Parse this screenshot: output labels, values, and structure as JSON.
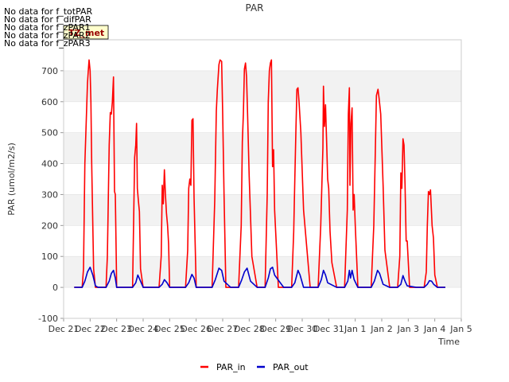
{
  "chart_data": {
    "type": "line",
    "title": "PAR",
    "xlabel": "Time",
    "ylabel": "PAR (umol/m2/s)",
    "ylim": [
      -100,
      800
    ],
    "yticks": [
      -100,
      0,
      100,
      200,
      300,
      400,
      500,
      600,
      700
    ],
    "xlim": [
      "2021-12-21",
      "2022-01-05"
    ],
    "xticks": [
      "Dec 21",
      "Dec 22",
      "Dec 23",
      "Dec 24",
      "Dec 25",
      "Dec 26",
      "Dec 27",
      "Dec 28",
      "Dec 29",
      "Dec 30",
      "Dec 31",
      "Jan 1",
      "Jan 2",
      "Jan 3",
      "Jan 4",
      "Jan 5"
    ],
    "grid": "horizontal bands",
    "legend_position": "bottom-center",
    "no_data_messages": [
      "No data for f_totPAR",
      "No data for f_difPAR",
      "No data for f_zPAR1",
      "No data for f_zPAR2",
      "No data for f_zPAR3"
    ],
    "badge": "TZ_met",
    "series": [
      {
        "name": "PAR_in",
        "color": "#ff0000",
        "x": [
          0.4,
          0.7,
          0.75,
          0.8,
          0.9,
          0.93,
          0.96,
          1.0,
          1.03,
          1.06,
          1.1,
          1.13,
          1.2,
          1.25,
          1.3,
          1.6,
          1.65,
          1.72,
          1.76,
          1.8,
          1.84,
          1.88,
          1.9,
          1.92,
          1.95,
          2.0,
          2.3,
          2.6,
          2.68,
          2.72,
          2.75,
          2.78,
          2.82,
          2.86,
          2.9,
          3.0,
          3.3,
          3.6,
          3.68,
          3.72,
          3.76,
          3.8,
          3.84,
          3.88,
          3.92,
          3.96,
          4.0,
          4.3,
          4.6,
          4.68,
          4.72,
          4.76,
          4.8,
          4.84,
          4.88,
          4.92,
          4.96,
          5.0,
          5.3,
          5.6,
          5.7,
          5.76,
          5.8,
          5.86,
          5.9,
          5.96,
          6.0,
          6.05,
          6.12,
          6.3,
          6.6,
          6.7,
          6.74,
          6.78,
          6.82,
          6.86,
          6.9,
          6.94,
          7.0,
          7.1,
          7.3,
          7.6,
          7.68,
          7.72,
          7.76,
          7.8,
          7.84,
          7.88,
          7.92,
          7.96,
          8.1,
          8.3,
          8.6,
          8.68,
          8.72,
          8.76,
          8.8,
          8.84,
          8.88,
          8.95,
          9.05,
          9.3,
          9.6,
          9.7,
          9.74,
          9.78,
          9.8,
          9.84,
          9.88,
          9.92,
          9.96,
          10.0,
          10.05,
          10.12,
          10.3,
          10.6,
          10.7,
          10.74,
          10.78,
          10.8,
          10.84,
          10.88,
          10.92,
          10.96,
          11.0,
          11.1,
          11.3,
          11.6,
          11.7,
          11.76,
          11.8,
          11.86,
          11.9,
          11.96,
          12.0,
          12.05,
          12.12,
          12.3,
          12.6,
          12.68,
          12.72,
          12.76,
          12.8,
          12.84,
          12.88,
          12.92,
          12.96,
          13.05,
          13.3,
          13.6,
          13.68,
          13.72,
          13.76,
          13.8,
          13.84,
          13.9,
          13.95,
          14.0,
          14.1,
          14.4
        ],
        "y": [
          0,
          0,
          60,
          400,
          660,
          700,
          735,
          700,
          600,
          400,
          200,
          60,
          0,
          0,
          0,
          0,
          100,
          460,
          565,
          560,
          600,
          680,
          500,
          310,
          300,
          0,
          0,
          0,
          420,
          460,
          530,
          320,
          280,
          245,
          60,
          0,
          0,
          0,
          100,
          330,
          270,
          380,
          300,
          240,
          200,
          140,
          0,
          0,
          0,
          120,
          320,
          350,
          330,
          540,
          545,
          290,
          150,
          0,
          0,
          0,
          280,
          570,
          640,
          720,
          735,
          730,
          560,
          300,
          0,
          0,
          0,
          200,
          470,
          560,
          705,
          725,
          680,
          560,
          360,
          100,
          0,
          0,
          300,
          600,
          700,
          725,
          735,
          390,
          445,
          250,
          0,
          0,
          0,
          180,
          350,
          500,
          640,
          645,
          600,
          500,
          250,
          0,
          0,
          200,
          330,
          450,
          650,
          520,
          590,
          470,
          350,
          320,
          180,
          80,
          0,
          0,
          250,
          560,
          645,
          330,
          530,
          580,
          250,
          300,
          200,
          0,
          0,
          0,
          200,
          450,
          620,
          640,
          610,
          560,
          460,
          330,
          120,
          0,
          0,
          100,
          370,
          320,
          480,
          460,
          330,
          150,
          150,
          0,
          0,
          0,
          50,
          200,
          310,
          300,
          315,
          200,
          160,
          40,
          0,
          0
        ]
      },
      {
        "name": "PAR_out",
        "color": "#0000cc",
        "x": [
          0.4,
          0.7,
          0.8,
          0.9,
          1.0,
          1.1,
          1.2,
          1.3,
          1.6,
          1.72,
          1.8,
          1.88,
          1.95,
          2.0,
          2.3,
          2.6,
          2.72,
          2.8,
          2.9,
          3.0,
          3.3,
          3.6,
          3.72,
          3.8,
          3.9,
          4.0,
          4.3,
          4.6,
          4.72,
          4.84,
          4.92,
          5.0,
          5.3,
          5.6,
          5.72,
          5.86,
          5.96,
          6.05,
          6.3,
          6.6,
          6.72,
          6.82,
          6.92,
          7.05,
          7.3,
          7.6,
          7.72,
          7.8,
          7.88,
          7.96,
          8.3,
          8.6,
          8.72,
          8.84,
          8.92,
          9.05,
          9.3,
          9.6,
          9.72,
          9.8,
          9.88,
          9.96,
          10.3,
          10.6,
          10.72,
          10.78,
          10.82,
          10.88,
          10.96,
          11.1,
          11.3,
          11.6,
          11.72,
          11.84,
          11.92,
          12.05,
          12.3,
          12.6,
          12.72,
          12.8,
          12.88,
          12.96,
          13.3,
          13.6,
          13.72,
          13.8,
          13.88,
          13.96,
          14.1,
          14.4
        ],
        "y": [
          0,
          0,
          20,
          50,
          65,
          40,
          5,
          0,
          0,
          20,
          45,
          55,
          30,
          0,
          0,
          0,
          15,
          40,
          20,
          0,
          0,
          0,
          10,
          25,
          15,
          0,
          0,
          0,
          15,
          42,
          30,
          0,
          0,
          0,
          25,
          62,
          55,
          20,
          0,
          0,
          25,
          50,
          62,
          20,
          0,
          0,
          30,
          60,
          65,
          40,
          0,
          0,
          15,
          55,
          40,
          0,
          0,
          0,
          25,
          55,
          40,
          15,
          0,
          0,
          20,
          55,
          30,
          55,
          25,
          0,
          0,
          0,
          20,
          55,
          45,
          10,
          0,
          0,
          10,
          38,
          20,
          5,
          0,
          0,
          10,
          22,
          20,
          10,
          0,
          0
        ]
      }
    ]
  }
}
